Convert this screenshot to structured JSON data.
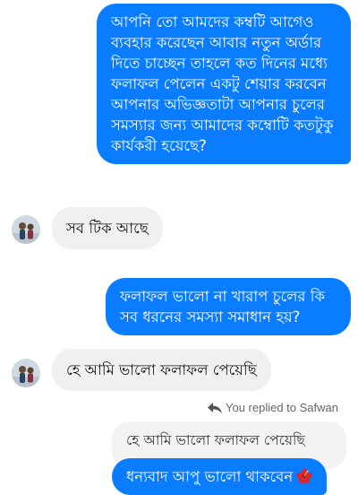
{
  "messages": [
    {
      "id": "m1",
      "direction": "outgoing",
      "text": "আপনি তো আমদের কম্বটি আগেও ব্যবহার করেছেন আবার নতুন অর্ডার দিতে চাচ্ছেন তাহলে কত দিনের মধ্যে ফলাফল পেলেন একটু শেয়ার করবেন আপনার অভিজ্ঞতাটা আপনার চুলের সমস্যার জন্য আমাদের কম্বোটি কতটুকু কার্যকরী হয়েছে?"
    },
    {
      "id": "m2",
      "direction": "incoming",
      "text": "সব টিক  আছে"
    },
    {
      "id": "m3",
      "direction": "outgoing",
      "text": "ফলাফল ভালো না খারাপ চুলের কি সব ধরনের সমস্যা সমাধান হয়?"
    },
    {
      "id": "m4",
      "direction": "incoming",
      "text": "হে আমি  ভালো  ফলাফল  পেয়েছি"
    }
  ],
  "reply": {
    "note": "You replied to Safwan",
    "quoted_text": "হে আমি  ভালো  ফলাফল  পেয়েছি",
    "text": "ধন্যবাদ আপু ভালো থাকবেন",
    "emoji": "hibiscus"
  },
  "colors": {
    "outgoing_bubble": "#0a7cff",
    "incoming_bubble": "#f0f0f0",
    "background": "#ffffff"
  }
}
